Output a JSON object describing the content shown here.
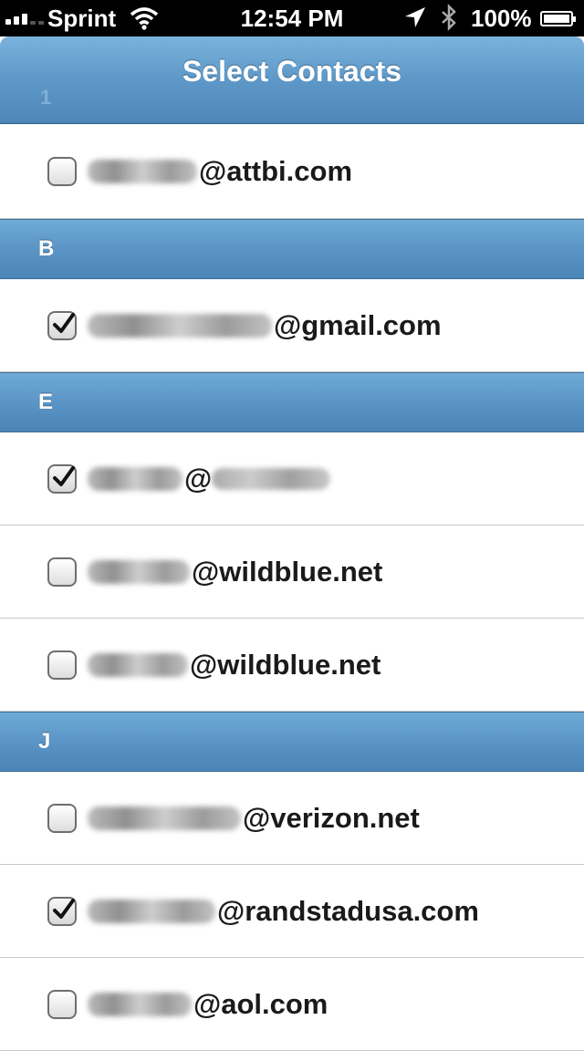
{
  "status_bar": {
    "carrier": "Sprint",
    "time": "12:54 PM",
    "battery": "100%"
  },
  "nav": {
    "title": "Select Contacts",
    "peek_header": "1"
  },
  "sections": [
    {
      "header": "",
      "contacts": [
        {
          "domain": "@attbi.com",
          "checked": false
        }
      ]
    },
    {
      "header": "B",
      "contacts": [
        {
          "domain": "@gmail.com",
          "checked": true
        }
      ]
    },
    {
      "header": "E",
      "contacts": [
        {
          "domain": "@",
          "checked": true
        },
        {
          "domain": "@wildblue.net",
          "checked": false
        },
        {
          "domain": "@wildblue.net",
          "checked": false
        }
      ]
    },
    {
      "header": "J",
      "contacts": [
        {
          "domain": "@verizon.net",
          "checked": false
        },
        {
          "domain": "@randstadusa.com",
          "checked": true
        },
        {
          "domain": "@aol.com",
          "checked": false
        }
      ]
    }
  ],
  "icons": {
    "wifi": "wifi-icon",
    "location": "location-arrow-icon",
    "bluetooth": "bluetooth-icon",
    "battery": "battery-icon",
    "checkbox_checked": "checkmark-icon"
  }
}
